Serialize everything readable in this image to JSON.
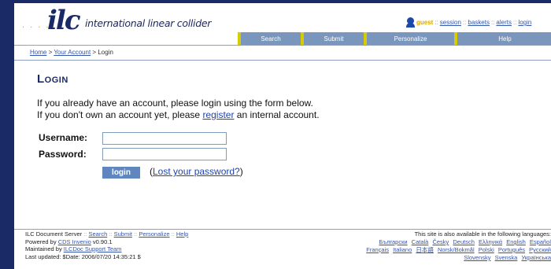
{
  "header": {
    "logo_dots": ". . . .",
    "logo_text": "ilc",
    "brand": "international linear collider",
    "user": "guest",
    "links": [
      "session",
      "baskets",
      "alerts",
      "login"
    ]
  },
  "tabs": [
    "Search",
    "Submit",
    "Personalize",
    "Help"
  ],
  "breadcrumb": {
    "home": "Home",
    "sep1": ">",
    "account": "Your Account",
    "sep2": ">",
    "current": "Login"
  },
  "main": {
    "title": "Login",
    "line1": "If you already have an account, please login using the form below.",
    "line2_pre": "If you don't own an account yet, please ",
    "line2_link": "register",
    "line2_post": " an internal account.",
    "username_label": "Username:",
    "password_label": "Password:",
    "username_value": "",
    "password_value": "",
    "login_button": "login",
    "lost_open": "(",
    "lost_link": "Lost your password?",
    "lost_close": ")"
  },
  "footer": {
    "server": "ILC Document Server",
    "nav": [
      "Search",
      "Submit",
      "Personalize",
      "Help"
    ],
    "powered_pre": "Powered by ",
    "powered_link": "CDS Invenio",
    "powered_version": " v0.90.1",
    "maintained_pre": "Maintained by ",
    "maintained_link": "ILCDoc Support Team",
    "updated": "Last updated: $Date: 2006/07/20 14:35:21 $",
    "lang_intro": "This site is also available in the following languages:",
    "languages": [
      "Български",
      "Català",
      "Česky",
      "Deutsch",
      "Ελληνικά",
      "English",
      "Español",
      "Français",
      "Italiano",
      "日本語",
      "Norsk/Bokmål",
      "Polski",
      "Português",
      "Русский",
      "Slovensky",
      "Svenska",
      "Українська"
    ]
  },
  "colors": {
    "accent": "#1a2a66",
    "tab_bg": "#7a96bc",
    "tab_marker": "#d8cc00",
    "guest": "#e0a800",
    "button": "#5f86bf"
  }
}
